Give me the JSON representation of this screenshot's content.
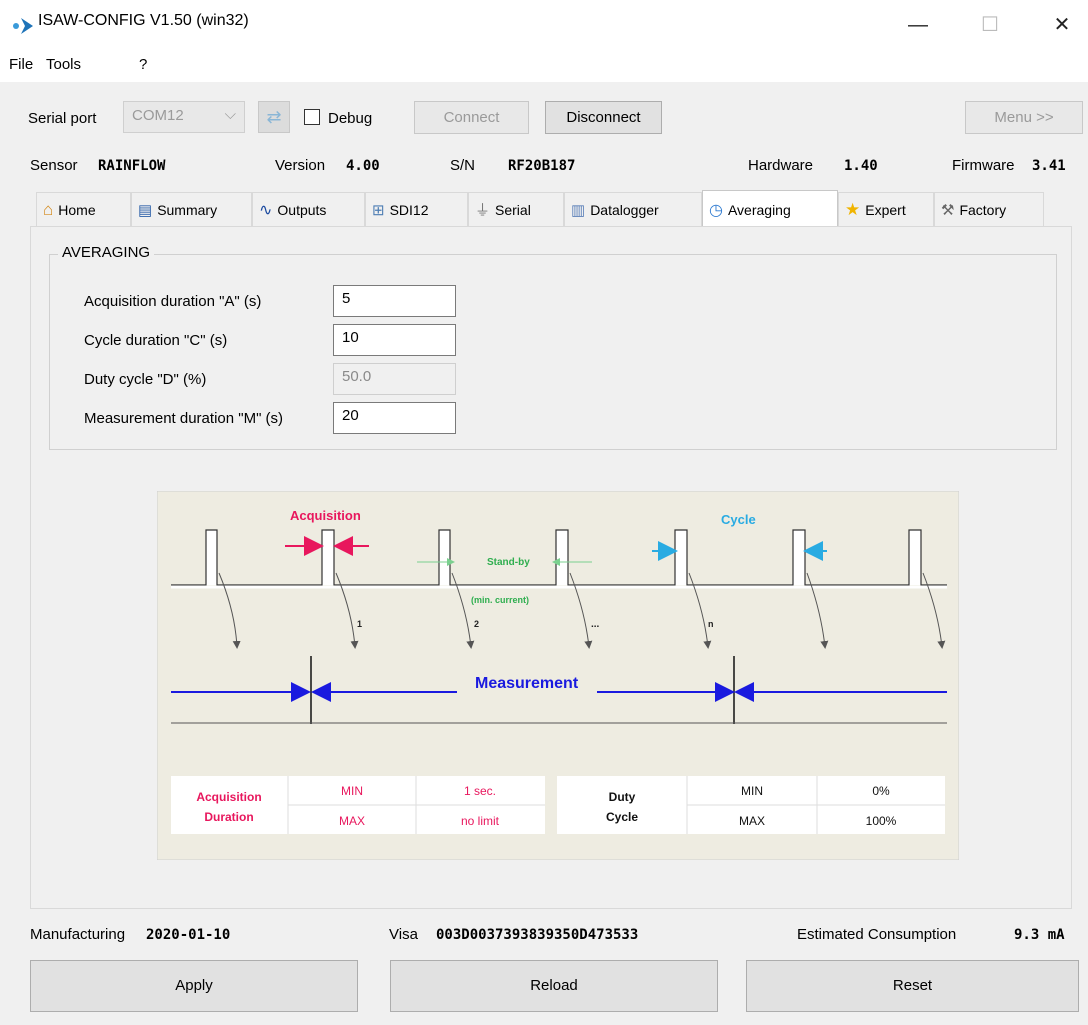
{
  "window": {
    "title": "ISAW-CONFIG V1.50 (win32)",
    "minimize": "—",
    "maximize": "☐",
    "close": "✕"
  },
  "menu": {
    "file": "File",
    "tools": "Tools",
    "help": "?"
  },
  "toolbar": {
    "serial_port_label": "Serial port",
    "serial_port_value": "COM12",
    "debug_label": "Debug",
    "connect_label": "Connect",
    "disconnect_label": "Disconnect",
    "menu_label": "Menu >>"
  },
  "info": {
    "sensor_label": "Sensor",
    "sensor_value": "RAINFLOW",
    "version_label": "Version",
    "version_value": "4.00",
    "sn_label": "S/N",
    "sn_value": "RF20B187",
    "hardware_label": "Hardware",
    "hardware_value": "1.40",
    "firmware_label": "Firmware",
    "firmware_value": "3.41"
  },
  "tabs": [
    {
      "label": "Home",
      "icon": "home-icon"
    },
    {
      "label": "Summary",
      "icon": "summary-icon"
    },
    {
      "label": "Outputs",
      "icon": "wave-icon"
    },
    {
      "label": "SDI12",
      "icon": "network-icon"
    },
    {
      "label": "Serial",
      "icon": "plug-icon"
    },
    {
      "label": "Datalogger",
      "icon": "database-icon"
    },
    {
      "label": "Averaging",
      "icon": "clock-icon"
    },
    {
      "label": "Expert",
      "icon": "star-icon"
    },
    {
      "label": "Factory",
      "icon": "tools-icon"
    }
  ],
  "averaging": {
    "group_title": "AVERAGING",
    "acq_label": "Acquisition duration \"A\" (s)",
    "acq_value": "5",
    "cycle_label": "Cycle duration \"C\" (s)",
    "cycle_value": "10",
    "duty_label": "Duty cycle \"D\" (%)",
    "duty_value": "50.0",
    "meas_label": "Measurement duration \"M\" (s)",
    "meas_value": "20"
  },
  "diagram": {
    "acquisition": "Acquisition",
    "cycle": "Cycle",
    "standby": "Stand-by",
    "min_current": "(min. current)",
    "n1": "1",
    "n2": "2",
    "ndots": "...",
    "nn": "n",
    "measurement": "Measurement",
    "table": {
      "acq_title_1": "Acquisition",
      "acq_title_2": "Duration",
      "min": "MIN",
      "max": "MAX",
      "acq_min": "1 sec.",
      "acq_max": "no limit",
      "duty_title_1": "Duty",
      "duty_title_2": "Cycle",
      "duty_min": "0%",
      "duty_max": "100%"
    },
    "colors": {
      "pink": "#e8175d",
      "blue": "#1a1adf",
      "cyan": "#29abe2",
      "green": "#2fae4f",
      "bg": "#eeece1"
    }
  },
  "footer": {
    "manufacturing_label": "Manufacturing",
    "manufacturing_value": "2020-01-10",
    "visa_label": "Visa",
    "visa_value": "003D0037393839350D473533",
    "consumption_label": "Estimated Consumption",
    "consumption_value": "9.3 mA",
    "apply": "Apply",
    "reload": "Reload",
    "reset": "Reset"
  }
}
